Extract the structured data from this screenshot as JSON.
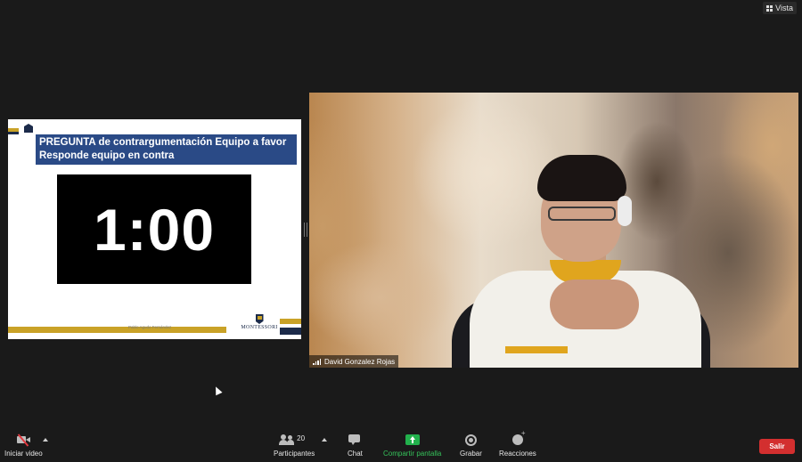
{
  "view_button": {
    "label": "Vista",
    "icon": "grid-icon"
  },
  "shared_slide": {
    "header_line1": "PREGUNTA de contrargumentación Equipo a favor",
    "header_line2": "Responde equipo en contra",
    "timer": "1:00",
    "footer_text": "Pablo Agudo Fernández",
    "logo_text": "MONTESSORI",
    "colors": {
      "gold": "#c9a227",
      "navy": "#1c2b4a",
      "header": "#2a4a86"
    }
  },
  "participant": {
    "name": "David Gonzalez Rojas"
  },
  "toolbar": {
    "video": {
      "label": "Iniciar video",
      "icon": "video-off-icon"
    },
    "participants": {
      "label": "Participantes",
      "count": "20",
      "icon": "people-icon"
    },
    "chat": {
      "label": "Chat",
      "icon": "chat-icon"
    },
    "share": {
      "label": "Compartir pantalla",
      "icon": "share-screen-icon",
      "color": "#35c25a"
    },
    "record": {
      "label": "Grabar",
      "icon": "record-icon"
    },
    "reactions": {
      "label": "Reacciones",
      "icon": "reaction-icon"
    },
    "leave": {
      "label": "Salir",
      "color": "#d32f2f"
    }
  }
}
